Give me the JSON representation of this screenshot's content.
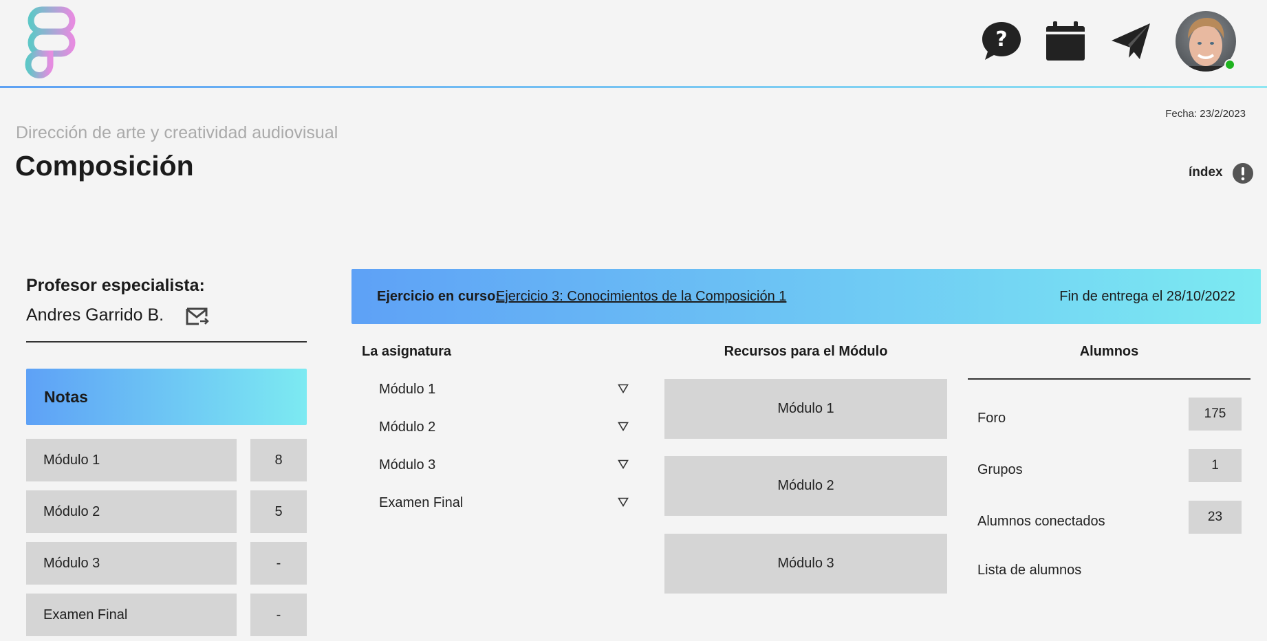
{
  "header": {
    "logo_icon": "figma-logo",
    "icons": [
      "help-chat-icon",
      "calendar-icon",
      "paper-plane-icon"
    ],
    "avatar": "user-avatar",
    "online_color": "#1fb31f"
  },
  "page": {
    "date": "Fecha: 23/2/2023",
    "subtitle": "Dirección de arte y creatividad audiovisual",
    "title": "Composición",
    "index_label": "índex"
  },
  "teacher": {
    "label": "Profesor especialista:",
    "name": "Andres Garrido B."
  },
  "grades": {
    "title": "Notas",
    "rows": [
      {
        "name": "Módulo 1",
        "value": "8"
      },
      {
        "name": "Módulo 2",
        "value": "5"
      },
      {
        "name": "Módulo 3",
        "value": "-"
      },
      {
        "name": "Examen Final",
        "value": "-"
      }
    ]
  },
  "exercise": {
    "label": "Ejercicio en curso:",
    "link": "Ejercicio 3: Conocimientos de la Composición 1",
    "deadline": "Fin de entrega el 28/10/2022"
  },
  "subject": {
    "title": "La asignatura",
    "items": [
      "Módulo 1",
      "Módulo 2",
      "Módulo 3",
      "Examen Final"
    ]
  },
  "resources": {
    "title": "Recursos para el Módulo",
    "items": [
      "Módulo 1",
      "Módulo 2",
      "Módulo 3"
    ]
  },
  "students": {
    "title": "Alumnos",
    "rows": [
      {
        "label": "Foro",
        "value": "175"
      },
      {
        "label": "Grupos",
        "value": "1"
      },
      {
        "label": "Alumnos conectados",
        "value": "23"
      },
      {
        "label": "Lista de alumnos",
        "value": ""
      }
    ]
  },
  "colors": {
    "gradient_start": "#5ea1f6",
    "gradient_end": "#7ceaf2",
    "tile_bg": "#d5d5d5"
  }
}
